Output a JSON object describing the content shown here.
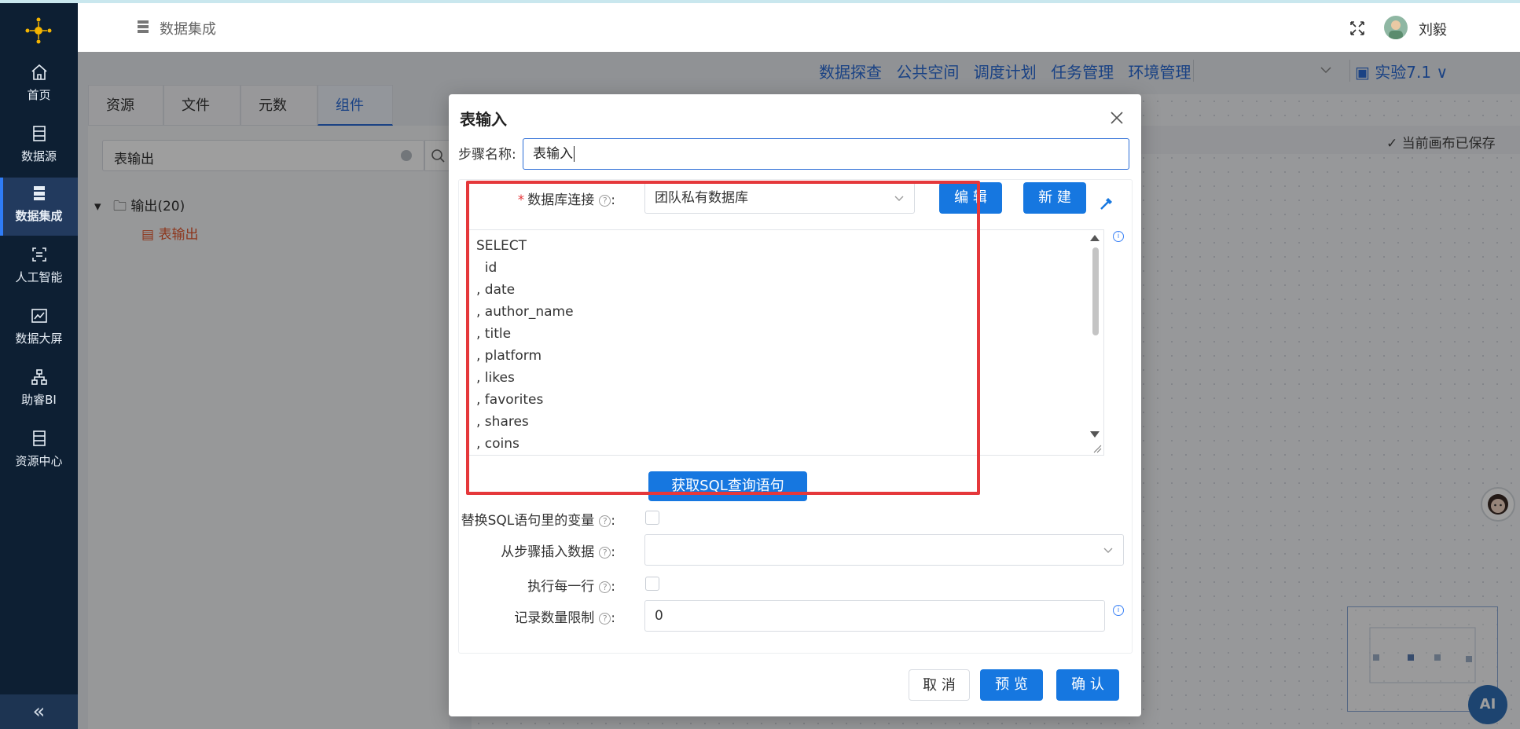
{
  "header": {
    "breadcrumb": "数据集成",
    "username": "刘毅"
  },
  "sidebar": {
    "items": [
      {
        "label": "首页"
      },
      {
        "label": "数据源"
      },
      {
        "label": "数据集成"
      },
      {
        "label": "人工智能"
      },
      {
        "label": "数据大屏"
      },
      {
        "label": "助睿BI"
      },
      {
        "label": "资源中心"
      }
    ],
    "collapse_label": "«"
  },
  "top_menu": {
    "items": [
      "数据探查",
      "公共空间",
      "调度计划",
      "任务管理",
      "环境管理"
    ],
    "version": "实验7.1"
  },
  "tabs": [
    "资源库",
    "文件库",
    "元数据",
    "组件库"
  ],
  "search": {
    "value": "表输出"
  },
  "tree": {
    "root": "输出(20)",
    "leaf": "表输出"
  },
  "canvas": {
    "saved_status": "当前画布已保存",
    "ai_label": "AI"
  },
  "dialog": {
    "title": "表输入",
    "step_name_label": "步骤名称:",
    "step_name_value": "表输入",
    "db_connection_label": "数据库连接",
    "db_connection_value": "团队私有数据库",
    "edit_button": "编 辑",
    "new_button": "新 建",
    "sql_lines": [
      "SELECT",
      "  id",
      ", date",
      ", author_name",
      ", title",
      ", platform",
      ", likes",
      ", favorites",
      ", shares",
      ", coins"
    ],
    "get_sql_button": "获取SQL查询语句",
    "replace_vars_label": "替换SQL语句里的变量",
    "insert_from_step_label": "从步骤插入数据",
    "execute_each_row_label": "执行每一行",
    "record_limit_label": "记录数量限制",
    "record_limit_value": "0",
    "cancel_button": "取 消",
    "preview_button": "预 览",
    "confirm_button": "确 认"
  }
}
